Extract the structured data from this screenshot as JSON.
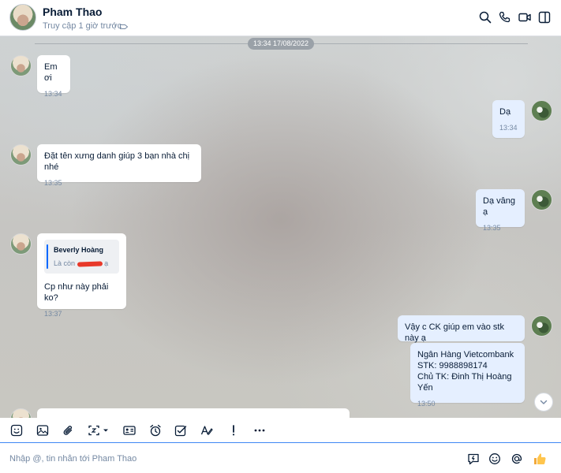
{
  "header": {
    "name": "Pham Thao",
    "status": "Truy cập 1 giờ trước"
  },
  "date_divider": "13:34 17/08/2022",
  "messages": [
    {
      "text": "Em ơi",
      "time": "13:34"
    },
    {
      "text": "Dạ",
      "time": "13:34"
    },
    {
      "text": "Đặt tên xưng danh giúp 3 bạn nhà chị nhé",
      "time": "13:35"
    },
    {
      "text": "Dạ vâng ạ",
      "time": "13:35"
    },
    {
      "quote_author": "Beverly Hoàng",
      "quote_prefix": "Là còn",
      "quote_suffix": "ạ",
      "text": "Cp như này phải ko?",
      "time": "13:37"
    },
    {
      "text": "Vậy c CK giúp em vào stk  này ạ"
    },
    {
      "text": "Ngân Hàng Vietcombank\nSTK: 9988898174\nChủ TK: Đinh Thị Hoàng Yến",
      "time": "13:50"
    }
  ],
  "composer": {
    "placeholder": "Nhập @, tin nhắn tới Pham Thao"
  },
  "colors": {
    "accent": "#0068ff",
    "incoming_bubble": "#ffffff",
    "outgoing_bubble": "#e5efff",
    "redaction": "#e8392a"
  },
  "icons": {
    "header": [
      "search-icon",
      "phone-icon",
      "video-call-icon",
      "sidebar-toggle-icon"
    ],
    "toolbar": [
      "sticker-icon",
      "image-icon",
      "attachment-icon",
      "screenshot-icon",
      "contact-card-icon",
      "reminder-icon",
      "todo-icon",
      "format-text-icon",
      "urgent-icon",
      "more-icon"
    ],
    "composer": [
      "quick-message-icon",
      "emoji-icon",
      "mention-icon",
      "thumbs-up-icon"
    ]
  }
}
